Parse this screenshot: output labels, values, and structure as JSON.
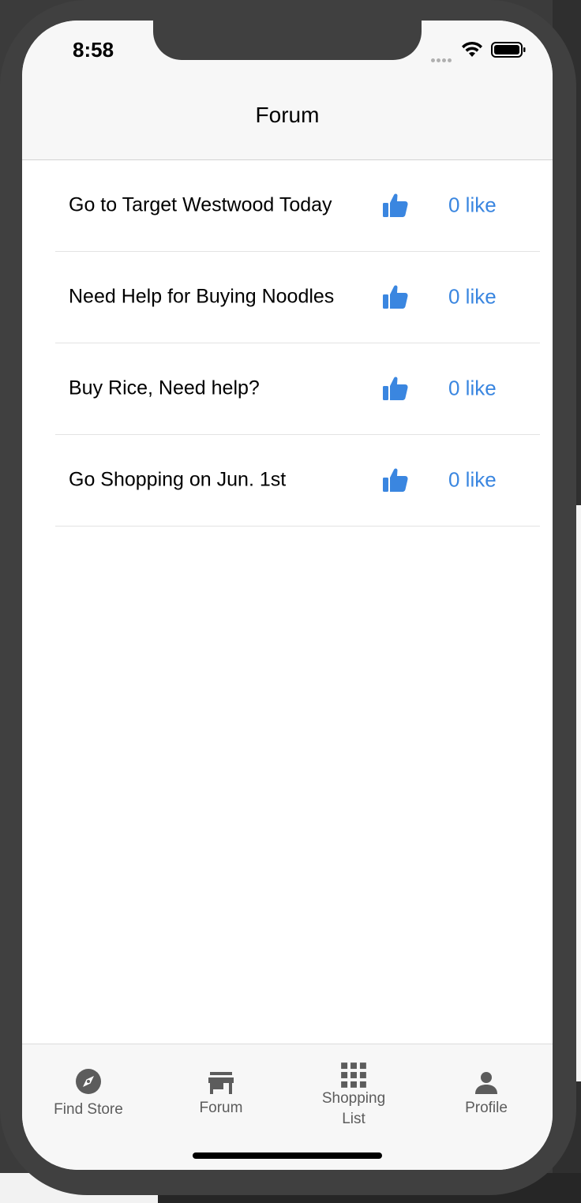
{
  "status_bar": {
    "time": "8:58",
    "wifi_icon": "wifi-icon",
    "battery_icon": "battery-icon"
  },
  "header": {
    "title": "Forum"
  },
  "posts": [
    {
      "title": "Go to Target Westwood Today",
      "likes": "0 like",
      "icon": "thumbs-up-icon"
    },
    {
      "title": "Need Help for Buying Noodles",
      "likes": "0 like",
      "icon": "thumbs-up-icon"
    },
    {
      "title": "Buy Rice, Need help?",
      "likes": "0 like",
      "icon": "thumbs-up-icon"
    },
    {
      "title": "Go Shopping on Jun. 1st",
      "likes": "0 like",
      "icon": "thumbs-up-icon"
    }
  ],
  "tabs": [
    {
      "label": "Find Store",
      "icon": "compass-icon"
    },
    {
      "label": "Forum",
      "icon": "store-icon"
    },
    {
      "label_line1": "Shopping",
      "label_line2": "List",
      "icon": "grid-icon"
    },
    {
      "label": "Profile",
      "icon": "person-icon"
    }
  ],
  "colors": {
    "accent": "#3a86e0",
    "header_bg": "#f7f7f7",
    "device_frame": "#404040",
    "tab_icon": "#5c5c5c"
  }
}
